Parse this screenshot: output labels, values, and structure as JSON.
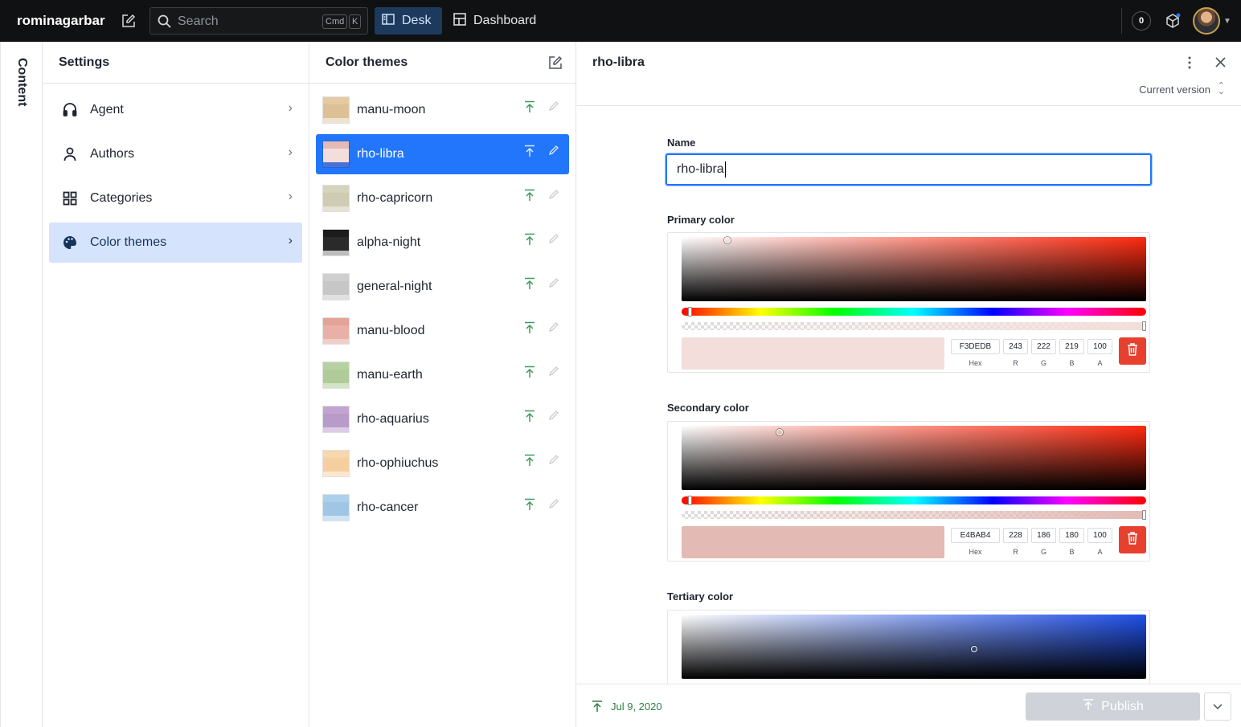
{
  "topbar": {
    "brand": "rominagarbar",
    "search_placeholder": "Search",
    "shortcut_cmd": "Cmd",
    "shortcut_key": "K",
    "desk_label": "Desk",
    "dashboard_label": "Dashboard",
    "notification_count": "0"
  },
  "strip": {
    "label": "Content"
  },
  "settings": {
    "title": "Settings",
    "items": [
      {
        "label": "Agent",
        "icon": "headset-icon"
      },
      {
        "label": "Authors",
        "icon": "user-icon"
      },
      {
        "label": "Categories",
        "icon": "grid-icon"
      },
      {
        "label": "Color themes",
        "icon": "palette-icon",
        "selected": true
      }
    ]
  },
  "themes": {
    "title": "Color themes",
    "items": [
      {
        "label": "manu-moon",
        "colors": [
          "#e4c9a3",
          "#dcc196",
          "#efe3d0"
        ]
      },
      {
        "label": "rho-libra",
        "colors": [
          "#e4bab4",
          "#f3dedb",
          "#4b6fd6"
        ],
        "selected": true
      },
      {
        "label": "rho-capricorn",
        "colors": [
          "#d6d3bd",
          "#cfccb3",
          "#e4e2d3"
        ]
      },
      {
        "label": "alpha-night",
        "colors": [
          "#1c1c1c",
          "#2a2a2a",
          "#bdbdbd"
        ]
      },
      {
        "label": "general-night",
        "colors": [
          "#cfcfcf",
          "#c7c7c7",
          "#e0e0e0"
        ]
      },
      {
        "label": "manu-blood",
        "colors": [
          "#e3a396",
          "#e8b0a6",
          "#f0cfc8"
        ]
      },
      {
        "label": "manu-earth",
        "colors": [
          "#b6d2a3",
          "#aecb98",
          "#d3e4c6"
        ]
      },
      {
        "label": "rho-aquarius",
        "colors": [
          "#c1a4cf",
          "#b89bc8",
          "#dccbe5"
        ]
      },
      {
        "label": "rho-ophiuchus",
        "colors": [
          "#f7d7ad",
          "#f5cf9e",
          "#fbe7cd"
        ]
      },
      {
        "label": "rho-cancer",
        "colors": [
          "#acd0ea",
          "#9fc6e5",
          "#cfe3f3"
        ]
      }
    ]
  },
  "document": {
    "title": "rho-libra",
    "version": "Current version",
    "name_label": "Name",
    "name_value": "rho-libra",
    "primary": {
      "label": "Primary color",
      "hue_color": "#ff2a0f",
      "preview": "#f3dedb",
      "hex": "F3DEDB",
      "r": "243",
      "g": "222",
      "b": "219",
      "a": "100"
    },
    "secondary": {
      "label": "Secondary color",
      "hue_color": "#ff2a0f",
      "preview": "#e4bab4",
      "hex": "E4BAB4",
      "r": "228",
      "g": "186",
      "b": "180",
      "a": "100"
    },
    "tertiary": {
      "label": "Tertiary color",
      "hue_color": "#1f4fe8"
    },
    "value_labels": {
      "hex": "Hex",
      "r": "R",
      "g": "G",
      "b": "B",
      "a": "A"
    }
  },
  "footer": {
    "date": "Jul 9, 2020",
    "publish_label": "Publish"
  },
  "colors": {
    "accent": "#2276fc",
    "selected_bg": "#d5e4fc",
    "danger": "#e8402f",
    "published_green": "#2f7d45"
  }
}
